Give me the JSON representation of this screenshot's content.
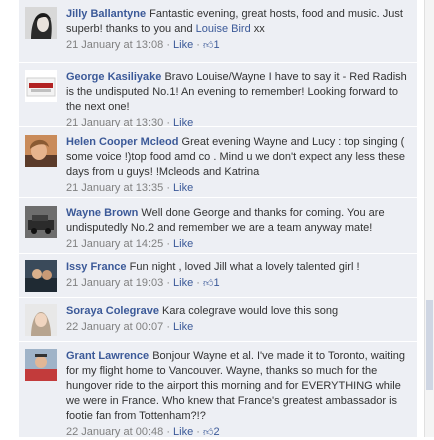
{
  "ui": {
    "like_label": "Like",
    "separator": "·",
    "like_icon": "thumbs-up-icon"
  },
  "comments": [
    {
      "author": "Jilly Ballantyne",
      "text": "Fantastic evening, great hosts, food and music. Just superb! thanks to you and ",
      "mention": "Louise Bird",
      "text_after": " xx",
      "timestamp": "21 January at 13:08",
      "likes": "1"
    },
    {
      "author": "George Kasiliyake",
      "text": "Bravo Louise/Wayne I have to say it - Red Radish is the undisputed No.1! An evening to remember! Looking forward to the next one!",
      "timestamp": "21 January at 13:30"
    },
    {
      "author": "Helen Cooper Mcleod",
      "text": "Great evening Wayne and Lucy : top singing ( some voice !)top food amd co . Mind u we don't expect any less these days from u guys! !Mcleods and Katrina",
      "timestamp": "21 January at 13:35"
    },
    {
      "author": "Wayne Brown",
      "text": "Well done George and thanks for coming. You are undisputedly No.2 and remember we are a team anyway mate!",
      "timestamp": "21 January at 14:25"
    },
    {
      "author": "Issy France",
      "text": "Fun night , loved Jill what a lovely talented girl !",
      "timestamp": "21 January at 19:03",
      "likes": "1"
    },
    {
      "author": "Soraya Colegrave",
      "text": "Kara colegrave would love this song",
      "timestamp": "22 January at 00:07"
    },
    {
      "author": "Grant Lawrence",
      "text": "Bonjour Wayne et al. I've made it to Toronto, waiting for my flight home to Vancouver. Wayne, thanks so much for the hungover ride to the airport this morning and for EVERYTHING while we were in France. Who knew that France's greatest ambassador is footie fan from Tottenham?!?",
      "timestamp": "22 January at 00:48",
      "likes": "2"
    }
  ]
}
